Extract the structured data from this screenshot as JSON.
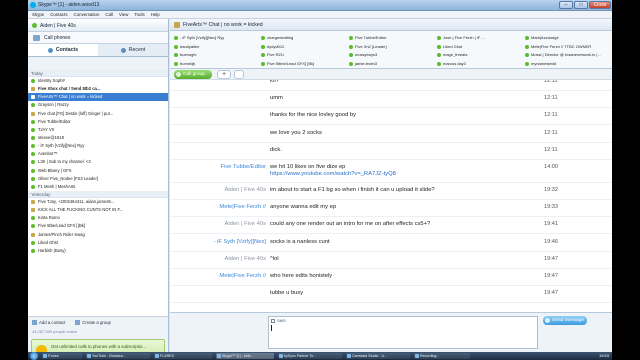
{
  "window": {
    "title": "Skype™ [1] - aiden.wood13",
    "controls": [
      "–",
      "□",
      "Close"
    ]
  },
  "menu": [
    "Skype",
    "Contacts",
    "Conversation",
    "Call",
    "View",
    "Tools",
    "Help"
  ],
  "sidebar": {
    "me": "Aiden | Five 40s",
    "call_phones": "Call phones",
    "tabs": {
      "contacts": "Contacts",
      "recent": "Recent"
    },
    "today_label": "Today",
    "yesterday_label": "Yesterday",
    "today": [
      {
        "name": "Identity Soph#",
        "bold": false,
        "group": false
      },
      {
        "name": "Five Xbox chat / Send 5tb2 ca...",
        "bold": true,
        "group": true
      },
      {
        "name": "FiveArts™ Chat | no work = kicked",
        "bold": false,
        "group": true,
        "selected": true
      },
      {
        "name": "Grayson | Razzy",
        "bold": false,
        "group": false
      },
      {
        "name": "Five chat [FG] Destin (loff) Ginger | put...",
        "bold": false,
        "group": true
      },
      {
        "name": "Five Tubbe/Editor",
        "bold": false,
        "group": false
      },
      {
        "name": "TJAY VII",
        "bold": false,
        "group": false
      },
      {
        "name": "steeve@1918",
        "bold": false,
        "group": false
      },
      {
        "name": "- iF Syth [Vzify][Nex] Ryy",
        "bold": false,
        "group": false
      },
      {
        "name": "Avenbot™",
        "bold": false,
        "group": false
      },
      {
        "name": "L3K | Sub to my channel. <3",
        "bold": false,
        "group": false
      },
      {
        "name": "Web Blarey | GFX",
        "bold": false,
        "group": false
      },
      {
        "name": "Oliver Five_Nodee [FS3 Leader]",
        "bold": false,
        "group": false
      },
      {
        "name": "F1 Mesh | MeshArts",
        "bold": false,
        "group": false
      }
    ],
    "yesterday": [
      {
        "name": "Five TJay, +2002464411, aidan.james9...",
        "bold": false,
        "group": true
      },
      {
        "name": "KICK ALL THE FUCKING CUNTS NOT IN F...",
        "bold": false,
        "group": true
      },
      {
        "name": "Kinta Rumo",
        "bold": false,
        "group": false
      },
      {
        "name": "Five 5tbe/Lead GFX] [Bk]",
        "bold": false,
        "group": false
      },
      {
        "name": "James/Pinch Rider Swag",
        "bold": false,
        "group": true
      },
      {
        "name": "Liked Ghst",
        "bold": false,
        "group": false
      },
      {
        "name": "Harbish (Busy)",
        "bold": false,
        "group": false
      }
    ],
    "actions": {
      "add_contact": "Add a contact",
      "create_group": "Create a group"
    },
    "online_count": "44,287,395 people online",
    "promo": "Get unlimited calls to phones with a subscriptio..."
  },
  "chat": {
    "title": "FiveArts™ Chat | no work = kicked",
    "members": [
      [
        "- iF Syth [Vzify][Nex] Ryy",
        "chargedediting",
        "Five Tubbe/Editor",
        "Josh | Five Ferzh | iF ...",
        "Mark|Azzdodge"
      ],
      [
        "bandyallen",
        "dydyd012",
        "Five Xh2 [Leader]",
        "Liked Ghst",
        "Mete|Five Ferzh // TTBC OWNER"
      ],
      [
        "buenogfx",
        "Five RZU",
        "mossyboys3",
        "mage_threats",
        "Mossi | Director @ Insanenetwork.tv |..."
      ],
      [
        "burnnbjk",
        "Five 5tbbe/Lead GFX] [Bk]",
        "jamie.lewin3",
        "marcus.day3",
        "mynamestedd"
      ]
    ],
    "call_group": "Call group",
    "add": "+",
    "messages": [
      {
        "sender": "",
        "color": "c-blue",
        "text": "lol?",
        "time": "12:11"
      },
      {
        "sender": "",
        "color": "c-blue",
        "text": "umm",
        "time": "12:11"
      },
      {
        "sender": "",
        "color": "c-blue",
        "text": "thanks for the nice lovley good by",
        "time": "12:11"
      },
      {
        "sender": "",
        "color": "c-blue",
        "text": "we love you 2 socks",
        "time": "12:11"
      },
      {
        "sender": "",
        "color": "c-blue",
        "text": "dick.",
        "time": "12:11"
      },
      {
        "sender": "Five Tubbe/Editor",
        "color": "c-blue",
        "text": "we hit 10 likes on five dize ep",
        "link": "https://www.youtube.com/watch?v=_RA7JZ-tyQ8",
        "time": "14:00"
      },
      {
        "sender": "Aiden | Five 40s",
        "color": "c-gray",
        "text": "im about to start a F1 bg so when i finish it can u upload it slide?",
        "time": "19:32"
      },
      {
        "sender": "Mete|Five Ferzh //",
        "color": "c-blue",
        "text": "anyone wanna edit my ep",
        "time": "19:33"
      },
      {
        "sender": "Aiden | Five 40s",
        "color": "c-gray",
        "text": "could any one render out an intro for me on after effects cs5+?",
        "time": "19:41"
      },
      {
        "sender": "- iF Syth [Vzify][Nex]",
        "color": "c-blue",
        "text": "socks is a nanless cunt",
        "time": "19:46"
      },
      {
        "sender": "Aiden | Five 40s",
        "color": "c-gray",
        "text": "^lol",
        "time": "19:47"
      },
      {
        "sender": "Mete|Five Ferzh //",
        "color": "c-blue",
        "text": "who here edits honistely",
        "time": "19:47"
      },
      {
        "sender": "",
        "color": "c-blue",
        "text": "tubbe u busy",
        "time": "19:47"
      }
    ],
    "sms_label": "SMS",
    "send_label": "Send message"
  },
  "taskbar": {
    "items": [
      "iTunes",
      "YouTube - Broadca...",
      "FLARES",
      "Skype™ [1] - aide...",
      "bySync Partner To...",
      "Camtasia Studio - U...",
      "Recording..."
    ],
    "clock": "19:53"
  },
  "colors": {
    "skype_blue": "#00aff0",
    "selected": "#3a7ed3",
    "online": "#5bbd2b",
    "sender_blue": "#3a87d8",
    "link": "#2a6fc7"
  }
}
